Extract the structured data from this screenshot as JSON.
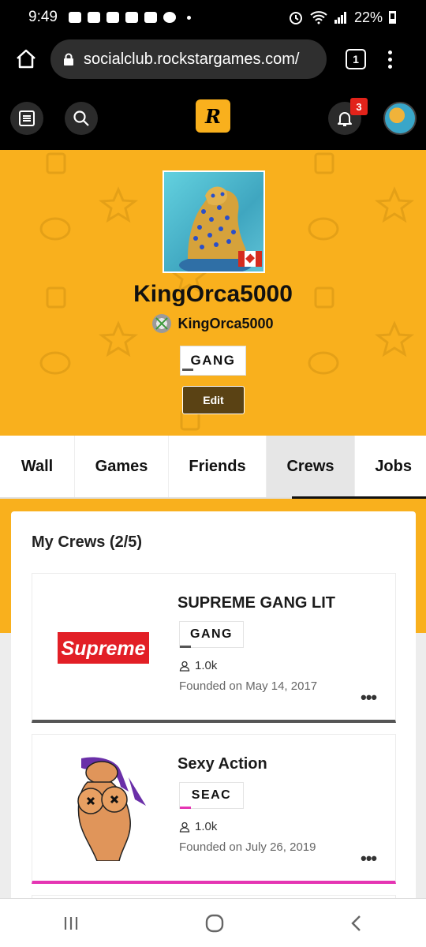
{
  "status_bar": {
    "time": "9:49",
    "battery": "22%"
  },
  "browser": {
    "url": "socialclub.rockstargames.com/",
    "tab_count": "1"
  },
  "header": {
    "logo_text": "R",
    "notification_count": "3"
  },
  "profile": {
    "username": "KingOrca5000",
    "platform_name": "KingOrca5000",
    "crew_tag": "GANG",
    "edit_label": "Edit"
  },
  "tabs": [
    "Wall",
    "Games",
    "Friends",
    "Crews",
    "Jobs"
  ],
  "active_tab": "Crews",
  "crews_section": {
    "title": "My Crews (2/5)",
    "crews": [
      {
        "name": "SUPREME GANG LIT",
        "tag": "GANG",
        "tag_color": "#555555",
        "members": "1.0k",
        "founded": "Founded on May 14, 2017",
        "logo_text": "Supreme",
        "accent": "#555555"
      },
      {
        "name": "Sexy Action",
        "tag": "SEAC",
        "tag_color": "#e535b3",
        "members": "1.0k",
        "founded": "Founded on July 26, 2019",
        "logo_text": "",
        "accent": "#e535b3"
      }
    ]
  },
  "colors": {
    "brand_yellow": "#f9b01d",
    "badge_red": "#e2231a",
    "edit_brown": "#5a4214"
  }
}
